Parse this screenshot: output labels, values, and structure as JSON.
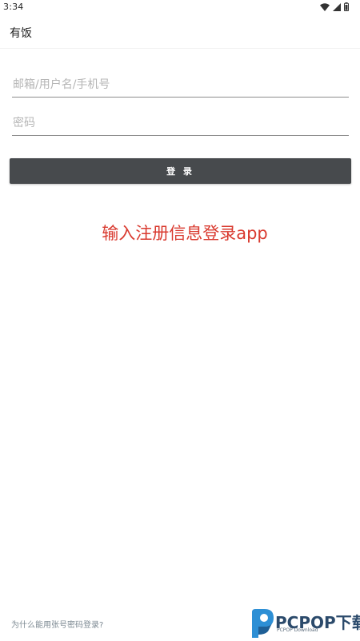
{
  "status_bar": {
    "time": "3:34"
  },
  "app_bar": {
    "title": "有饭"
  },
  "form": {
    "account_placeholder": "邮箱/用户名/手机号",
    "password_placeholder": "密码",
    "login_label": "登 录"
  },
  "annotation": "输入注册信息登录app",
  "footer": {
    "help_link": "为什么能用张号密码登录?"
  },
  "watermark": {
    "brand": "PCPOP下载",
    "sub": "PCPOP Download"
  },
  "colors": {
    "login_button": "#474a4d",
    "annotation": "#d93a2f",
    "input_underline": "#8c8c8c"
  },
  "icons": [
    "wifi-icon",
    "signal-icon",
    "battery-icon",
    "pcpop-logo-icon"
  ]
}
